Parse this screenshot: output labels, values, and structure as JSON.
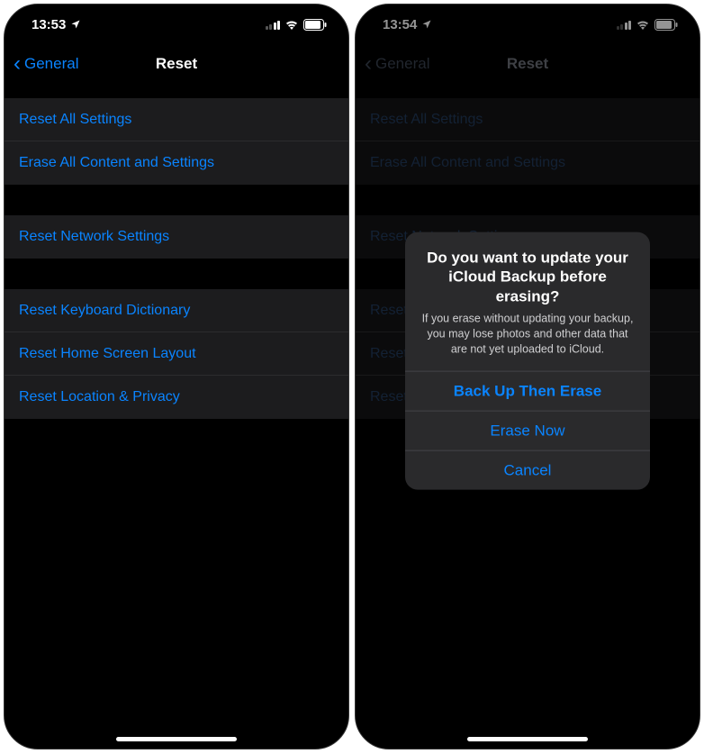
{
  "left": {
    "status": {
      "time": "13:53"
    },
    "nav": {
      "back": "General",
      "title": "Reset"
    },
    "groups": [
      [
        "Reset All Settings",
        "Erase All Content and Settings"
      ],
      [
        "Reset Network Settings"
      ],
      [
        "Reset Keyboard Dictionary",
        "Reset Home Screen Layout",
        "Reset Location & Privacy"
      ]
    ]
  },
  "right": {
    "status": {
      "time": "13:54"
    },
    "nav": {
      "back": "General",
      "title": "Reset"
    },
    "groups": [
      [
        "Reset All Settings",
        "Erase All Content and Settings"
      ],
      [
        "Reset Network Settings"
      ],
      [
        "Reset Keyboard Dictionary",
        "Reset Home Screen Layout",
        "Reset Location & Privacy"
      ]
    ],
    "alert": {
      "title": "Do you want to update your iCloud Backup before erasing?",
      "message": "If you erase without updating your backup, you may lose photos and other data that are not yet uploaded to iCloud.",
      "buttons": [
        "Back Up Then Erase",
        "Erase Now",
        "Cancel"
      ]
    }
  }
}
